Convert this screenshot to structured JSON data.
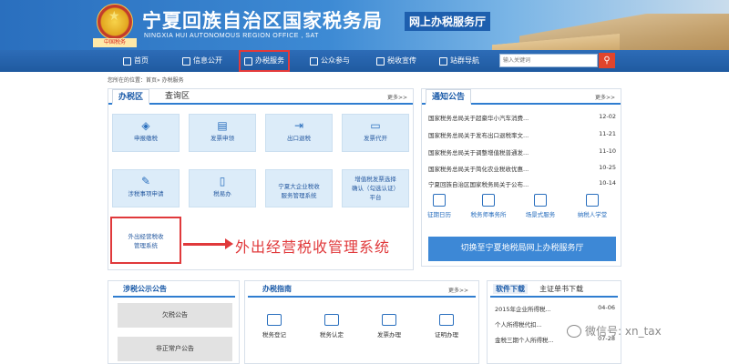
{
  "header": {
    "title_cn": "宁夏回族自治区国家税务局",
    "title_en": "NINGXIA HUI AUTONOMOUS REGION OFFICE , SAT",
    "hall_label": "网上办税服务厅",
    "emblem_caption": "中国税务"
  },
  "nav": {
    "items": [
      {
        "label": "首页",
        "icon": "home-icon"
      },
      {
        "label": "信息公开",
        "icon": "document-icon"
      },
      {
        "label": "办税服务",
        "icon": "edit-icon"
      },
      {
        "label": "公众参与",
        "icon": "people-icon"
      },
      {
        "label": "税收宣传",
        "icon": "book-icon"
      },
      {
        "label": "站群导航",
        "icon": "globe-icon"
      }
    ],
    "search_placeholder": "输入关键词"
  },
  "breadcrumb": "您所在的位置：首页» 办税服务",
  "service_panel": {
    "tab_active": "办税区",
    "tab_other": "查询区",
    "more": "更多>>",
    "tiles": [
      {
        "label": "申报缴税",
        "icon": "tax-icon"
      },
      {
        "label": "发票申领",
        "icon": "invoice-icon"
      },
      {
        "label": "出口退税",
        "icon": "export-icon"
      },
      {
        "label": "发票代开",
        "icon": "printer-icon"
      },
      {
        "label": "涉税事项申请",
        "icon": "edit-icon"
      },
      {
        "label": "税易办",
        "icon": "phone-icon"
      },
      {
        "label": "宁夏大企业税收服务管理系统",
        "label_l1": "宁夏大企业税收",
        "label_l2": "服务管理系统"
      },
      {
        "label": "增值税发票选择确认（勾选认证）平台",
        "label_l1": "增值税发票选择",
        "label_l2": "确认（勾选认证）",
        "label_l3": "平台"
      },
      {
        "label": "外出经营税收管理系统",
        "label_l1": "外出经营税收",
        "label_l2": "管理系统"
      }
    ],
    "annotation": "外出经营税收管理系统"
  },
  "notice_panel": {
    "title": "通知公告",
    "more": "更多>>",
    "items": [
      {
        "text": "国家税务总局关于超豪华小汽车消费...",
        "date": "12-02"
      },
      {
        "text": "国家税务总局关于发布出口退税率文...",
        "date": "11-21"
      },
      {
        "text": "国家税务总局关于调整增值税普通发...",
        "date": "11-10"
      },
      {
        "text": "国家税务总局关于简化农业税收优惠...",
        "date": "10-25"
      },
      {
        "text": "宁夏回族自治区国家税务局关于公布...",
        "date": "10-14"
      }
    ],
    "quick": [
      {
        "label": "征期日历",
        "icon": "calendar-icon"
      },
      {
        "label": "税务师事务所",
        "icon": "building-icon"
      },
      {
        "label": "场景式服务",
        "icon": "scene-icon"
      },
      {
        "label": "纳税人学堂",
        "icon": "school-icon"
      }
    ],
    "switch_label": "切换至宁夏地税局网上办税服务厅"
  },
  "tax_public": {
    "title": "涉税公示公告",
    "items": [
      "欠税公告",
      "非正常户公告"
    ]
  },
  "guide": {
    "title": "办税指南",
    "more": "更多>>",
    "items": [
      {
        "label": "税务登记",
        "icon": "register-icon"
      },
      {
        "label": "税务认定",
        "icon": "certify-icon"
      },
      {
        "label": "发票办理",
        "icon": "printer-icon"
      },
      {
        "label": "证明办理",
        "icon": "stamp-icon"
      }
    ]
  },
  "software": {
    "tab_active": "软件下载",
    "tab_other": "主证单书下载",
    "items": [
      {
        "text": "2015年企业所得税...",
        "date": "04-06"
      },
      {
        "text": "个人所得税代扣...",
        "date": ""
      },
      {
        "text": "金税三期个人所得税...",
        "date": "07-28"
      }
    ]
  },
  "watermark": "微信号: xn_tax"
}
